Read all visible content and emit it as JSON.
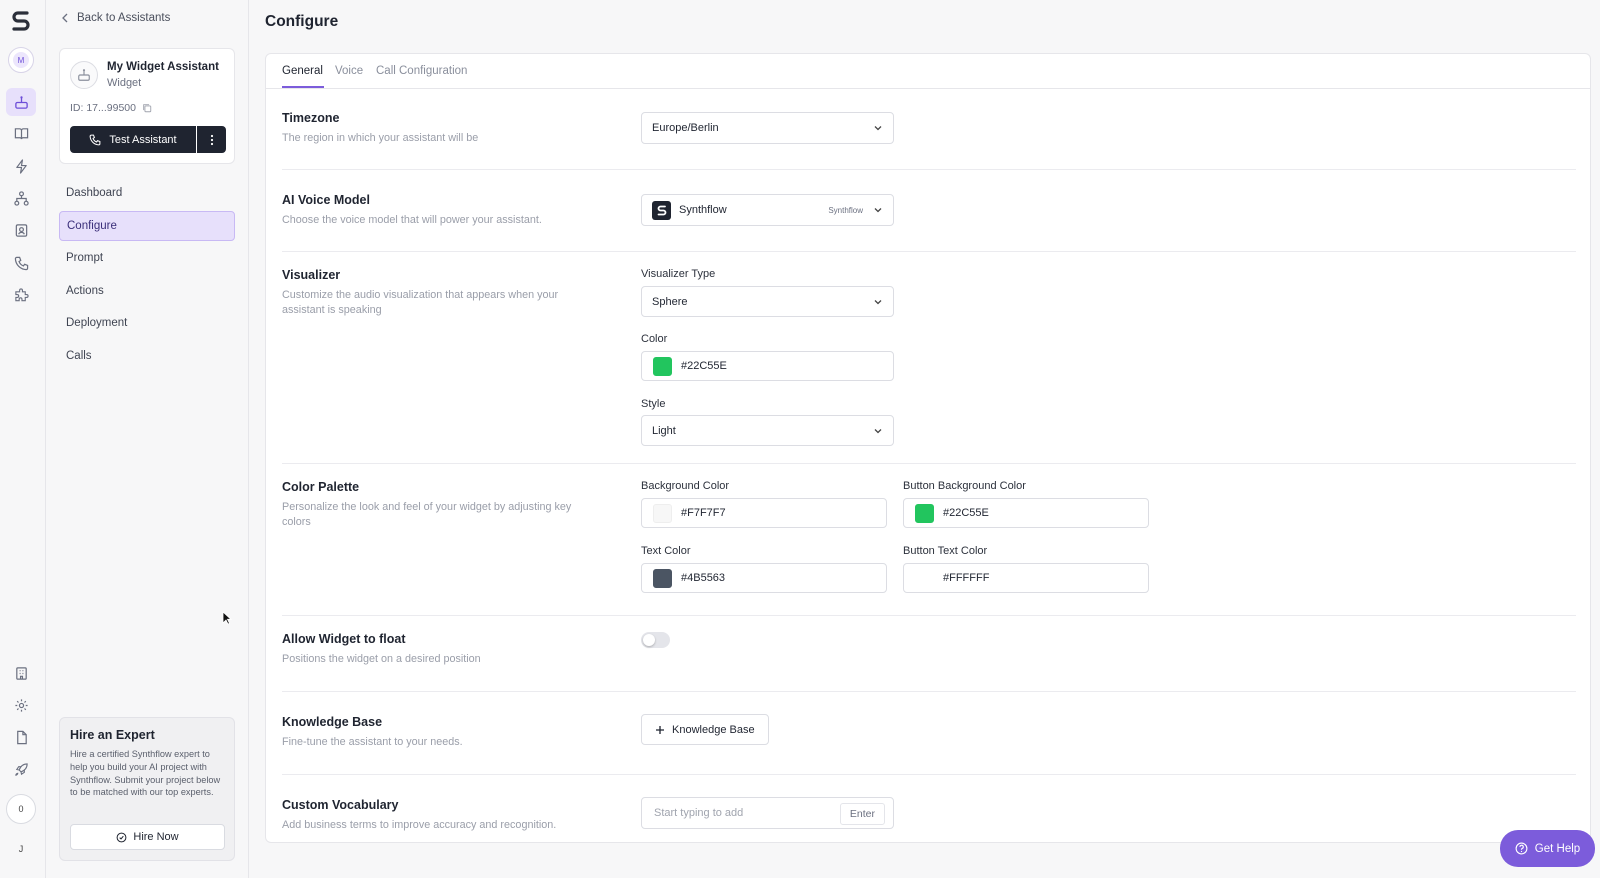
{
  "sidebar": {
    "back_label": "Back to Assistants",
    "assistant": {
      "name": "My Widget Assistant",
      "type": "Widget",
      "id": "ID: 17...99500",
      "test_button": "Test Assistant"
    },
    "nav": [
      "Dashboard",
      "Configure",
      "Prompt",
      "Actions",
      "Deployment",
      "Calls"
    ],
    "active_nav": "Configure",
    "expert": {
      "title": "Hire an Expert",
      "text": "Hire a certified Synthflow expert to help you build your AI project with Synthflow. Submit your project below to be matched with our top experts.",
      "button": "Hire Now"
    }
  },
  "rail": {
    "avatar_initial": "M",
    "badge_count": "0",
    "user_initial": "J",
    "icons": [
      "synthflow-logo-icon",
      "assistant-icon",
      "book-icon",
      "bolt-icon",
      "workflow-icon",
      "contacts-icon",
      "phone-icon",
      "puzzle-icon",
      "building-icon",
      "gear-icon",
      "document-icon",
      "rocket-icon"
    ]
  },
  "page": {
    "title": "Configure",
    "tabs": [
      "General",
      "Voice",
      "Call Configuration"
    ],
    "active_tab": "General"
  },
  "settings": {
    "timezone": {
      "title": "Timezone",
      "desc": "The region in which your assistant will be",
      "value": "Europe/Berlin"
    },
    "voice_model": {
      "title": "AI Voice Model",
      "desc": "Choose the voice model that will power your assistant.",
      "value": "Synthflow",
      "tag": "Synthflow"
    },
    "visualizer": {
      "title": "Visualizer",
      "desc": "Customize the audio visualization that appears when your assistant is speaking",
      "type_label": "Visualizer Type",
      "type_value": "Sphere",
      "color_label": "Color",
      "color_value": "#22C55E",
      "style_label": "Style",
      "style_value": "Light"
    },
    "palette": {
      "title": "Color Palette",
      "desc": "Personalize the look and feel of your widget by adjusting key colors",
      "bg_label": "Background Color",
      "bg_value": "#F7F7F7",
      "btn_bg_label": "Button Background Color",
      "btn_bg_value": "#22C55E",
      "text_label": "Text Color",
      "text_value": "#4B5563",
      "btn_text_label": "Button Text Color",
      "btn_text_value": "#FFFFFF"
    },
    "float": {
      "title": "Allow Widget to float",
      "desc": "Positions the widget on a desired position",
      "enabled": false
    },
    "knowledge": {
      "title": "Knowledge Base",
      "desc": "Fine-tune the assistant to your needs.",
      "button": "Knowledge Base"
    },
    "vocabulary": {
      "title": "Custom Vocabulary",
      "desc": "Add business terms to improve accuracy and recognition.",
      "placeholder": "Start typing to add",
      "enter": "Enter"
    }
  },
  "help_button": "Get Help",
  "colors": {
    "accent": "#7C5CDB",
    "active_bg": "#E7E0FB",
    "dark_button": "#1F2430"
  }
}
